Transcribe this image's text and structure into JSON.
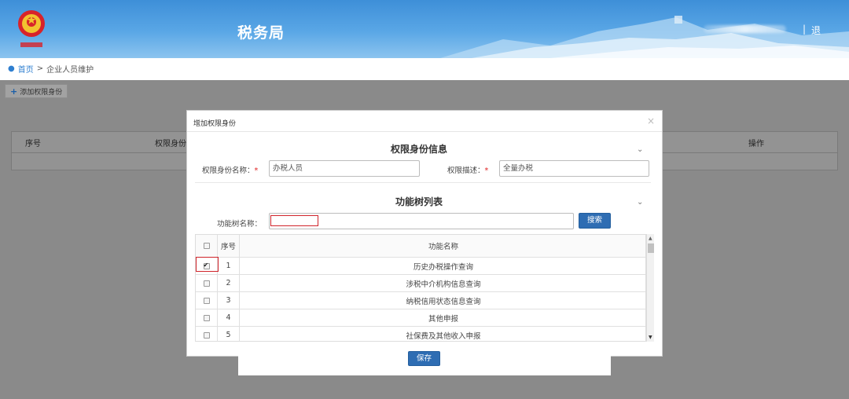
{
  "header": {
    "title": "税务局",
    "separator": "|",
    "exit_label": "退",
    "brand_color": "#4a9be0"
  },
  "breadcrumb": {
    "home": "首页",
    "sep": ">",
    "current": "企业人员维护"
  },
  "toolbar": {
    "add_label": "添加权限身份"
  },
  "bg_table": {
    "col_index": "序号",
    "col_name": "权限身份",
    "col_action": "操作"
  },
  "modal": {
    "title": "增加权限身份",
    "close": "×",
    "section_info": "权限身份信息",
    "name_label": "权限身份名称：",
    "name_value": "办税人员",
    "desc_label": "权限描述：",
    "desc_value": "全量办税",
    "required_mark": "*",
    "section_tree": "功能树列表",
    "tree_name_label": "功能树名称：",
    "tree_name_value": "",
    "search_label": "搜索",
    "table": {
      "header_index": "序号",
      "header_name": "功能名称",
      "rows": [
        {
          "index": "1",
          "name": "历史办税操作查询",
          "checked": true
        },
        {
          "index": "2",
          "name": "涉税中介机构信息查询",
          "checked": false
        },
        {
          "index": "3",
          "name": "纳税信用状态信息查询",
          "checked": false
        },
        {
          "index": "4",
          "name": "其他申报",
          "checked": false
        },
        {
          "index": "5",
          "name": "社保费及其他收入申报",
          "checked": false
        }
      ]
    },
    "save_label": "保存"
  }
}
